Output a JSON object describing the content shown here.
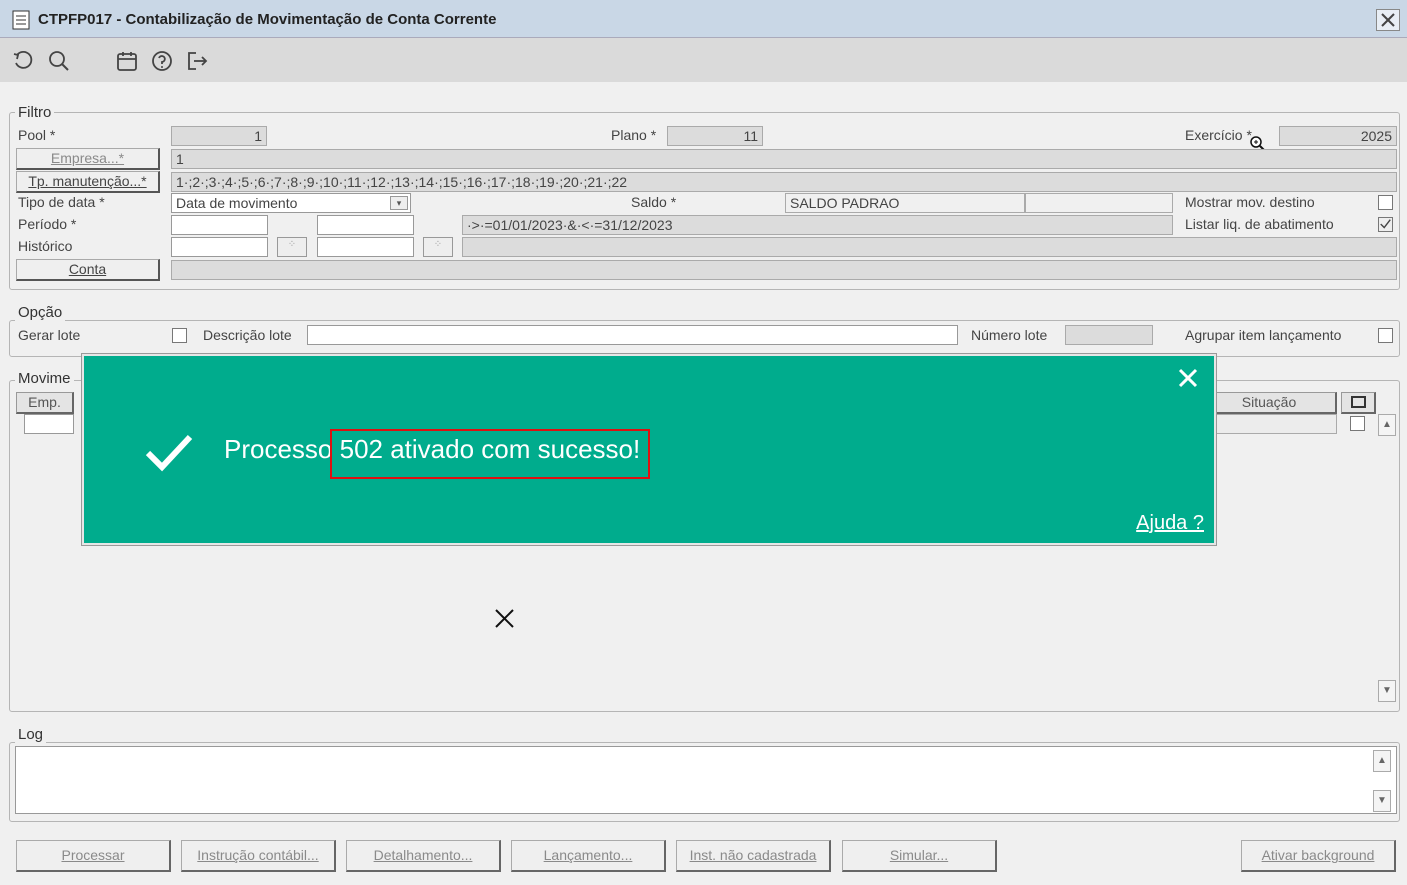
{
  "window": {
    "title": "CTPFP017 - Contabilização de Movimentação de Conta Corrente",
    "close_icon": "close-icon"
  },
  "toolbar": {
    "icons": [
      "refresh-icon",
      "search-icon",
      "calendar-icon",
      "help-icon",
      "exit-icon"
    ]
  },
  "filtro": {
    "legend": "Filtro",
    "pool_label": "Pool *",
    "pool_value": "1",
    "plano_label": "Plano *",
    "plano_value": "11",
    "exercicio_label": "Exercício *",
    "exercicio_value": "2025",
    "empresa_button": "Empresa...*",
    "empresa_value": "1",
    "tp_manutencao_button": "Tp. manutenção...*",
    "tp_manutencao_value": "1·;2·;3·;4·;5·;6·;7·;8·;9·;10·;11·;12·;13·;14·;15·;16·;17·;18·;19·;20·;21·;22",
    "tipo_data_label": "Tipo de data *",
    "tipo_data_value": "Data de movimento",
    "saldo_label": "Saldo *",
    "saldo_value": "SALDO PADRAO",
    "mostrar_mov_destino_label": "Mostrar mov. destino",
    "mostrar_mov_destino_checked": false,
    "periodo_label": "Período *",
    "periodo_expr": "·>·=01/01/2023·&·<·=31/12/2023",
    "listar_liq_label": "Listar liq. de abatimento",
    "listar_liq_checked": true,
    "historico_label": "Histórico",
    "conta_button": "Conta"
  },
  "opcao": {
    "legend": "Opção",
    "gerar_lote_label": "Gerar lote",
    "descricao_lote_label": "Descrição lote",
    "numero_lote_label": "Número lote",
    "agrupar_label": "Agrupar item lançamento"
  },
  "movimentos": {
    "legend": "Movime",
    "col_emp": "Emp.",
    "col_situacao": "Situação"
  },
  "log": {
    "legend": "Log"
  },
  "buttons": {
    "processar": "Processar",
    "instrucao": "Instrução contábil...",
    "detalhamento": "Detalhamento...",
    "lancamento": "Lançamento...",
    "inst_nao_cadastrada": "Inst. não cadastrada",
    "simular": "Simular...",
    "ativar_background": "Ativar background"
  },
  "toast": {
    "message_prefix": "Processo ",
    "message_highlight": "502 ativado com sucesso!",
    "help_link": "Ajuda ?",
    "color": "#00ac8d"
  }
}
